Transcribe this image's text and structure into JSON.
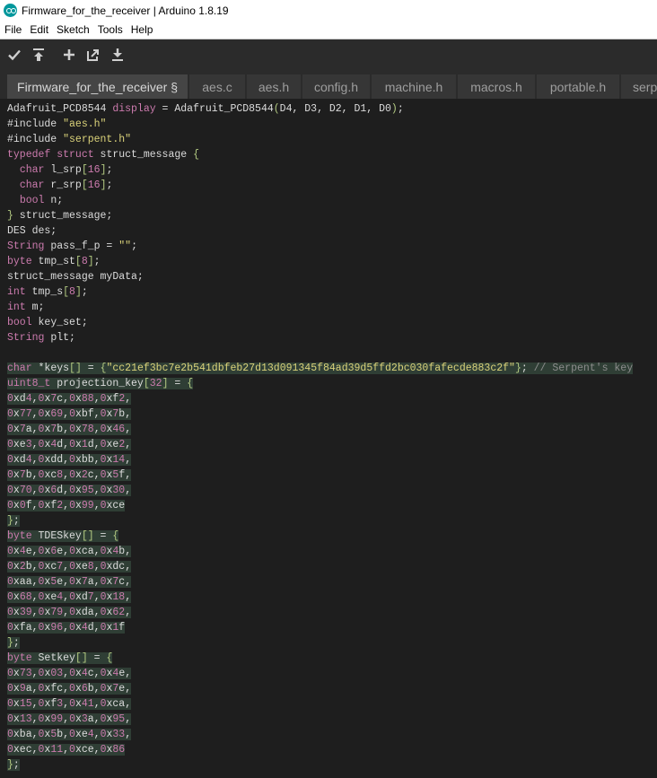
{
  "window": {
    "title": "Firmware_for_the_receiver | Arduino 1.8.19"
  },
  "menu": [
    "File",
    "Edit",
    "Sketch",
    "Tools",
    "Help"
  ],
  "toolbar": {
    "buttons": [
      "verify-icon",
      "upload-icon",
      "new-icon",
      "open-icon",
      "save-icon"
    ]
  },
  "tabs": [
    {
      "label": "Firmware_for_the_receiver §",
      "active": true
    },
    {
      "label": "aes.c"
    },
    {
      "label": "aes.h"
    },
    {
      "label": "config.h"
    },
    {
      "label": "machine.h"
    },
    {
      "label": "macros.h"
    },
    {
      "label": "portable.h"
    },
    {
      "label": "serp"
    }
  ],
  "code": [
    "Adafruit_PCD8544 display = Adafruit_PCD8544(D4, D3, D2, D1, D0);",
    "#include \"aes.h\"",
    "#include \"serpent.h\"",
    "typedef struct struct_message {",
    "  char l_srp[16];",
    "  char r_srp[16];",
    "  bool n;",
    "} struct_message;",
    "DES des;",
    "String pass_f_p = \"\";",
    "byte tmp_st[8];",
    "struct_message myData;",
    "int tmp_s[8];",
    "int m;",
    "bool key_set;",
    "String plt;",
    "",
    "char *keys[] = {\"cc21ef3bc7e2b541dbfeb27d13d091345f84ad39d5ffd2bc030fafecde883c2f\"}; // Serpent's key",
    "uint8_t projection_key[32] = {",
    "0xd4,0x7c,0x88,0xf2,",
    "0x77,0x69,0xbf,0x7b,",
    "0x7a,0x7b,0x78,0x46,",
    "0xe3,0x4d,0x1d,0xe2,",
    "0xd4,0xdd,0xbb,0x14,",
    "0x7b,0xc8,0x2c,0x5f,",
    "0x70,0x6d,0x95,0x30,",
    "0x0f,0xf2,0x99,0xce",
    "};",
    "byte TDESkey[] = {",
    "0x4e,0x6e,0xca,0x4b,",
    "0x2b,0xc7,0xe8,0xdc,",
    "0xaa,0x5e,0x7a,0x7c,",
    "0x68,0xe4,0xd7,0x18,",
    "0x39,0x79,0xda,0x62,",
    "0xfa,0x96,0x4d,0x1f",
    "};",
    "byte Setkey[] = {",
    "0x73,0x03,0x4c,0x4e,",
    "0x9a,0xfc,0x6b,0x7e,",
    "0x15,0xf3,0x41,0xca,",
    "0x13,0x99,0x3a,0x95,",
    "0xba,0x5b,0xe4,0x33,",
    "0xec,0x11,0xce,0x86",
    "};"
  ]
}
